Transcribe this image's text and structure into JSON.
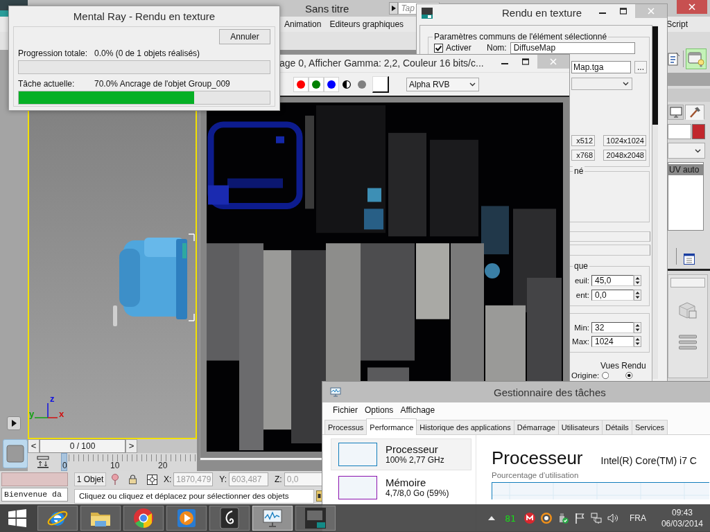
{
  "max_window": {
    "title": "Sans titre",
    "search": {
      "placeholder": "Tap"
    },
    "menu": [
      "Animation",
      "Editeurs graphiques",
      "Script"
    ],
    "viewport": {
      "axes": [
        {
          "label": "z",
          "color": "#1010e0"
        },
        {
          "label": "y",
          "color": "#10a010"
        },
        {
          "label": "x",
          "color": "#d01010"
        }
      ]
    },
    "time_slider": {
      "previous": "<",
      "position": "0 / 100",
      "next": ">",
      "ruler_labels": [
        "0",
        "10",
        "20"
      ]
    },
    "status": {
      "listener_output": "Bienvenue da",
      "selection": "1 Objet",
      "coordinates": [
        {
          "label": "X:",
          "value": "1870,479",
          "disabled": true
        },
        {
          "label": "Y:",
          "value": "603,487",
          "disabled": true
        },
        {
          "label": "Z:",
          "value": "0,0",
          "disabled": true
        }
      ],
      "prompt": "Cliquez ou cliquez et déplacez pour sélectionner des objets"
    },
    "command_panel": {
      "tabs": [
        {
          "kind": "display",
          "selected": false
        },
        {
          "kind": "utilities",
          "selected": true
        }
      ],
      "list": [
        {
          "label": "UV auto",
          "selected": true
        }
      ]
    }
  },
  "progress_dialog": {
    "title": "Mental Ray - Rendu en texture",
    "cancel_button": "Annuler",
    "rows": [
      {
        "label": "Progression totale:",
        "value": "0.0% (0 de 1 objets réalisés)",
        "level": 0
      },
      {
        "label": "Tâche actuelle:",
        "value": "70.0% Ancrage de l'objet Group_009",
        "level": 0.7
      }
    ]
  },
  "bake_window": {
    "title": "Rendu en texture",
    "group_title": "Paramètres communs de l'élément sélectionné",
    "enable": {
      "label": "Activer",
      "checked": true
    },
    "name": {
      "label": "Nom:",
      "value": "DiffuseMap"
    },
    "file": {
      "value": "Map.tga",
      "browse_button": "..."
    },
    "size_buttons": [
      "x512",
      "1024x1024",
      "x768",
      "2048x2048"
    ],
    "group_2_title": "né",
    "group_3_title": "que",
    "group_3_fields": [
      {
        "label": "euil:",
        "value": "45,0"
      },
      {
        "label": "ent:",
        "value": "0,0"
      }
    ],
    "group_4_fields": [
      {
        "label": "Min:",
        "value": "32"
      },
      {
        "label": "Max:",
        "value": "1024"
      }
    ],
    "views": {
      "title": "Vues Rendu",
      "label": "Origine:",
      "options": [
        {
          "selected": false
        },
        {
          "selected": true
        }
      ]
    }
  },
  "render_window": {
    "title": "age 0, Afficher Gamma: 2,2, Couleur 16 bits/c...",
    "channel_toggles": [
      {
        "kind": "dot",
        "color": "#ff0000",
        "on": true
      },
      {
        "kind": "dot",
        "color": "#008000",
        "on": true
      },
      {
        "kind": "dot",
        "color": "#0000ff",
        "on": true
      },
      {
        "kind": "mono",
        "on": false
      },
      {
        "kind": "dot",
        "color": "#808080",
        "on": false
      }
    ],
    "channel_select": "Alpha RVB"
  },
  "task_manager": {
    "title": "Gestionnaire des tâches",
    "menu": [
      "Fichier",
      "Options",
      "Affichage"
    ],
    "tabs": [
      {
        "label": "Processus",
        "selected": false
      },
      {
        "label": "Performance",
        "selected": true
      },
      {
        "label": "Historique des applications",
        "selected": false
      },
      {
        "label": "Démarrage",
        "selected": false
      },
      {
        "label": "Utilisateurs",
        "selected": false
      },
      {
        "label": "Détails",
        "selected": false
      },
      {
        "label": "Services",
        "selected": false
      }
    ],
    "resources": [
      {
        "name": "Processeur",
        "detail": "100% 2,77 GHz",
        "selected": true,
        "color": "#117dbb"
      },
      {
        "name": "Mémoire",
        "detail": "4,7/8,0 Go (59%)",
        "selected": false,
        "color": "#8b12ae"
      }
    ],
    "heading": "Processeur",
    "model": "Intel(R) Core(TM) i7 C",
    "graph_label": "Pourcentage d’utilisation"
  },
  "taskbar": {
    "apps": [
      {
        "kind": "globe",
        "selected": false
      },
      {
        "kind": "folder",
        "selected": false
      },
      {
        "kind": "ball",
        "selected": false
      },
      {
        "kind": "play",
        "selected": false
      },
      {
        "kind": "swirl",
        "selected": false
      },
      {
        "kind": "monitor",
        "selected": true
      },
      {
        "kind": "tile",
        "selected": false
      }
    ],
    "tray": {
      "counter": "81",
      "language": "FRA",
      "time": "09:43",
      "date": "06/03/2014"
    }
  }
}
